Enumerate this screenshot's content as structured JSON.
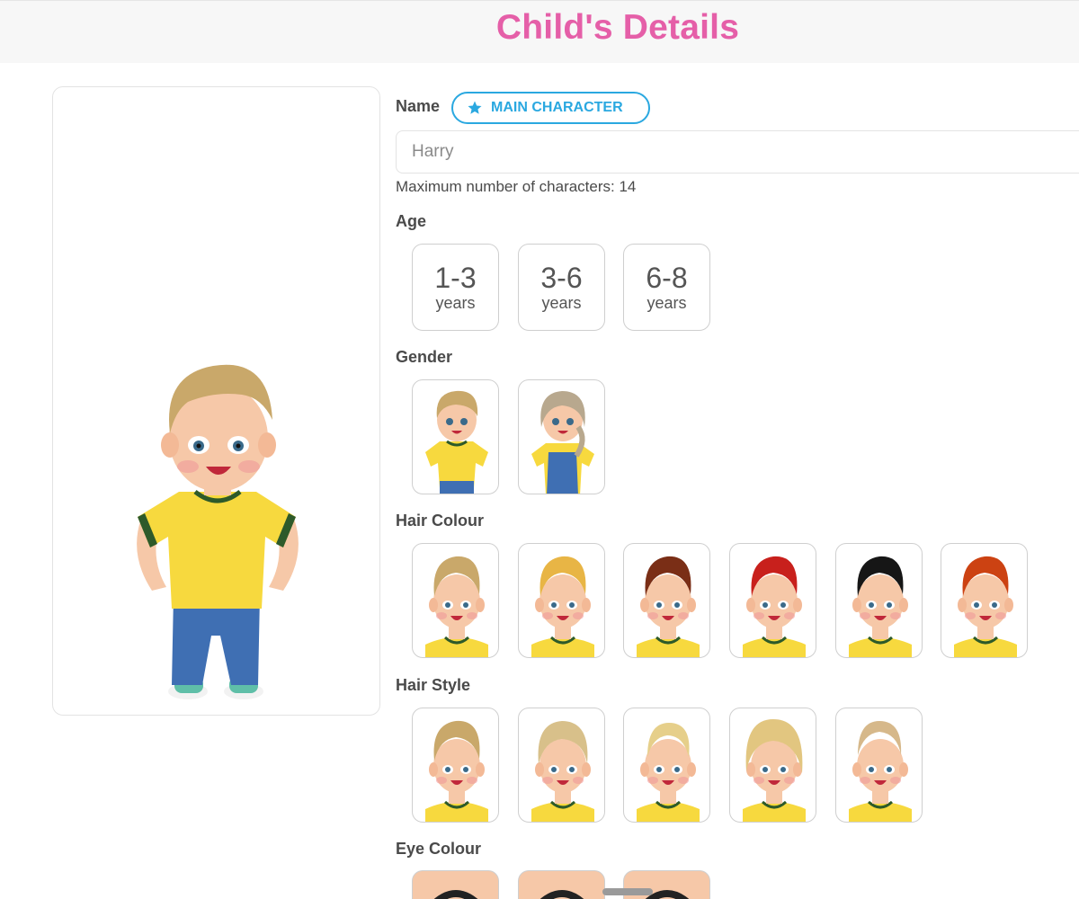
{
  "header": {
    "title": "Child's Details"
  },
  "form": {
    "name_label": "Name",
    "main_character_badge": "MAIN CHARACTER",
    "name_value": "Harry",
    "max_chars_hint": "Maximum number of characters: 14",
    "age_label": "Age",
    "age_options": [
      {
        "range": "1-3",
        "unit": "years"
      },
      {
        "range": "3-6",
        "unit": "years"
      },
      {
        "range": "6-8",
        "unit": "years"
      }
    ],
    "gender_label": "Gender",
    "gender_options": [
      "boy",
      "girl"
    ],
    "hair_colour_label": "Hair Colour",
    "hair_colours": [
      "#c9a86a",
      "#e8b545",
      "#7a2e16",
      "#c8201c",
      "#161616",
      "#cc4212"
    ],
    "hair_style_label": "Hair Style",
    "hair_styles": [
      "style-1",
      "style-2",
      "style-3",
      "style-4",
      "style-5"
    ],
    "eye_colour_label": "Eye Colour"
  },
  "colors": {
    "accent_pink": "#e55fa8",
    "accent_blue": "#2aa8e0",
    "shirt_yellow": "#f7d93e",
    "trousers_blue": "#3f6fb3",
    "skin": "#f6c8a8"
  }
}
